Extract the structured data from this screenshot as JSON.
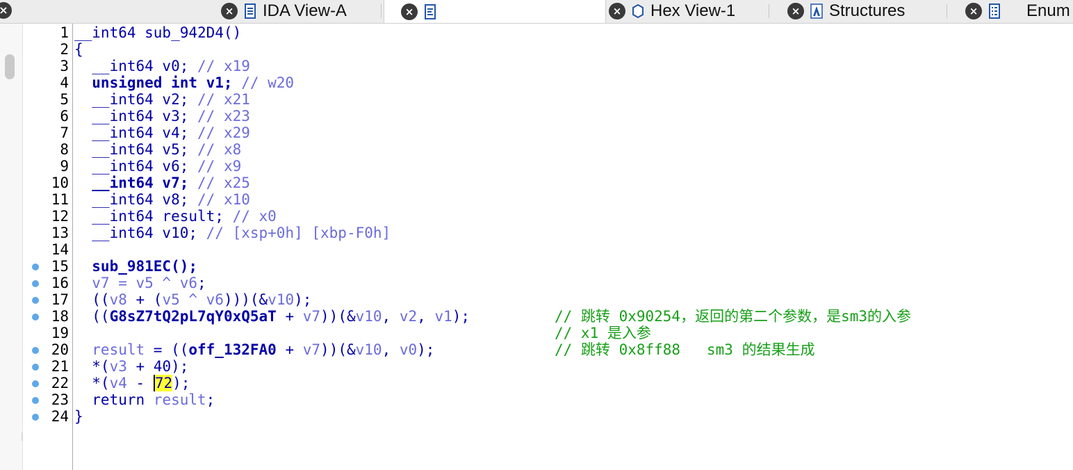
{
  "tabs": [
    {
      "label": "IDA View-A",
      "icon": "graph-view-icon"
    },
    {
      "label": "",
      "icon": "pseudocode-icon",
      "active": true
    },
    {
      "label": "Hex View-1",
      "icon": "hex-view-icon"
    },
    {
      "label": "Structures",
      "icon": "structures-icon"
    },
    {
      "label": "Enum",
      "icon": "enums-icon"
    }
  ],
  "colors": {
    "keyword": "#0000a8",
    "variable": "#6b6bdd",
    "comment": "#18a018",
    "highlight": "#ffff33",
    "breakpoint": "#5fa8e8"
  },
  "code": {
    "lines": [
      {
        "n": "1",
        "bp": false,
        "segs": [
          [
            "k",
            "__int64 sub_942D4()"
          ]
        ]
      },
      {
        "n": "2",
        "bp": false,
        "segs": [
          [
            "k",
            "{"
          ]
        ]
      },
      {
        "n": "3",
        "bp": false,
        "segs": [
          [
            "k",
            "  __int64 v0; "
          ],
          [
            "v",
            "// x19"
          ]
        ]
      },
      {
        "n": "4",
        "bp": false,
        "segs": [
          [
            "kb",
            "  unsigned int v1; "
          ],
          [
            "v",
            "// w20"
          ]
        ]
      },
      {
        "n": "5",
        "bp": false,
        "segs": [
          [
            "k",
            "  __int64 v2; "
          ],
          [
            "v",
            "// x21"
          ]
        ]
      },
      {
        "n": "6",
        "bp": false,
        "segs": [
          [
            "k",
            "  __int64 v3; "
          ],
          [
            "v",
            "// x23"
          ]
        ]
      },
      {
        "n": "7",
        "bp": false,
        "segs": [
          [
            "k",
            "  __int64 v4; "
          ],
          [
            "v",
            "// x29"
          ]
        ]
      },
      {
        "n": "8",
        "bp": false,
        "segs": [
          [
            "k",
            "  __int64 v5; "
          ],
          [
            "v",
            "// x8"
          ]
        ]
      },
      {
        "n": "9",
        "bp": false,
        "segs": [
          [
            "k",
            "  __int64 v6; "
          ],
          [
            "v",
            "// x9"
          ]
        ]
      },
      {
        "n": "10",
        "bp": false,
        "segs": [
          [
            "kb",
            "  __int64 v7; "
          ],
          [
            "v",
            "// x25"
          ]
        ]
      },
      {
        "n": "11",
        "bp": false,
        "segs": [
          [
            "k",
            "  __int64 v8; "
          ],
          [
            "v",
            "// x10"
          ]
        ]
      },
      {
        "n": "12",
        "bp": false,
        "segs": [
          [
            "k",
            "  __int64 result; "
          ],
          [
            "v",
            "// x0"
          ]
        ]
      },
      {
        "n": "13",
        "bp": false,
        "segs": [
          [
            "k",
            "  __int64 v10; "
          ],
          [
            "v",
            "// [xsp+0h] [xbp-F0h]"
          ]
        ]
      },
      {
        "n": "14",
        "bp": false,
        "segs": []
      },
      {
        "n": "15",
        "bp": true,
        "segs": [
          [
            "kb",
            "  sub_981EC();"
          ]
        ]
      },
      {
        "n": "16",
        "bp": true,
        "segs": [
          [
            "v",
            "  v7 = v5 ^ v6"
          ],
          [
            "k",
            ";"
          ]
        ]
      },
      {
        "n": "17",
        "bp": true,
        "segs": [
          [
            "k",
            "  (("
          ],
          [
            "v",
            "v8"
          ],
          [
            "k",
            " + ("
          ],
          [
            "v",
            "v5 ^ v6"
          ],
          [
            "k",
            ")))(&"
          ],
          [
            "v",
            "v10"
          ],
          [
            "k",
            ");"
          ]
        ]
      },
      {
        "n": "18",
        "bp": true,
        "segs": [
          [
            "k",
            "  (("
          ],
          [
            "kb",
            "G8sZ7tQ2pL7qY0xQ5aT"
          ],
          [
            "k",
            " + "
          ],
          [
            "v",
            "v7"
          ],
          [
            "k",
            "))(&"
          ],
          [
            "v",
            "v10"
          ],
          [
            "k",
            ", "
          ],
          [
            "v",
            "v2"
          ],
          [
            "k",
            ", "
          ],
          [
            "v",
            "v1"
          ],
          [
            "k",
            ");"
          ]
        ],
        "comment": "// 跳转 0x90254，返回的第二个参数，是sm3的入参"
      },
      {
        "n": "19",
        "bp": false,
        "segs": [],
        "comment": "// x1 是入参"
      },
      {
        "n": "20",
        "bp": true,
        "segs": [
          [
            "v",
            "  result"
          ],
          [
            "k",
            " = (("
          ],
          [
            "kb",
            "off_132FA0"
          ],
          [
            "k",
            " + "
          ],
          [
            "v",
            "v7"
          ],
          [
            "k",
            "))(&"
          ],
          [
            "v",
            "v10"
          ],
          [
            "k",
            ", "
          ],
          [
            "v",
            "v0"
          ],
          [
            "k",
            ");"
          ]
        ],
        "comment": "// 跳转 0x8ff88   sm3 的结果生成"
      },
      {
        "n": "21",
        "bp": true,
        "segs": [
          [
            "k",
            "  *("
          ],
          [
            "v",
            "v3"
          ],
          [
            "k",
            " + 40);"
          ]
        ]
      },
      {
        "n": "22",
        "bp": true,
        "segs": [
          [
            "k",
            "  *("
          ],
          [
            "v",
            "v4"
          ],
          [
            "k",
            " - "
          ],
          [
            "hl",
            "72"
          ],
          [
            "k",
            ");"
          ]
        ]
      },
      {
        "n": "23",
        "bp": true,
        "segs": [
          [
            "k",
            "  return "
          ],
          [
            "v",
            "result"
          ],
          [
            "k",
            ";"
          ]
        ]
      },
      {
        "n": "24",
        "bp": true,
        "segs": [
          [
            "k",
            "}"
          ]
        ]
      }
    ]
  }
}
